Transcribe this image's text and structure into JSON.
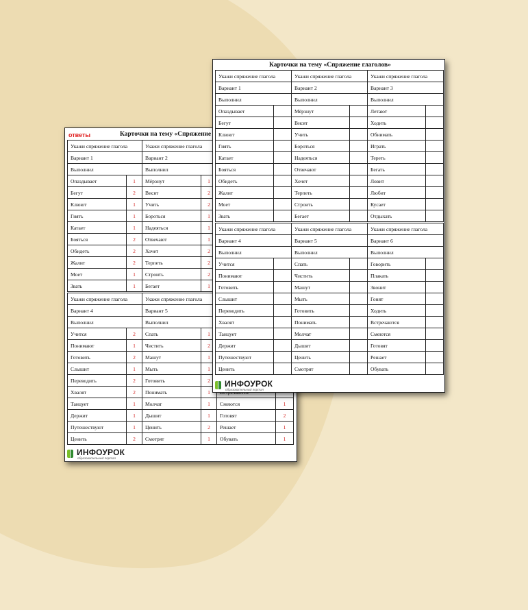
{
  "sheet_title": "Карточки на тему «Спряжение глаголов»",
  "answers_label": "ответы",
  "logo": {
    "name": "ИНФОУРОК",
    "tagline": "образовательный портал"
  },
  "labels": {
    "task": "Укажи спряжение глагола",
    "done": "Выполнил"
  },
  "cards": [
    {
      "variant": "Вариант 1",
      "verbs": [
        "Опаздывает",
        "Бегут",
        "Клюют",
        "Гиять",
        "Катает",
        "Бояться",
        "Обидеть",
        "Жалит",
        "Моет",
        "Звать"
      ],
      "answers": [
        "1",
        "2",
        "1",
        "1",
        "1",
        "2",
        "2",
        "2",
        "1",
        "1"
      ]
    },
    {
      "variant": "Вариант 2",
      "verbs": [
        "Мёрзнут",
        "Висят",
        "Учить",
        "Бороться",
        "Надеяться",
        "Отвечают",
        "Хочет",
        "Терпеть",
        "Строить",
        "Бегает"
      ],
      "answers": [
        "1",
        "2",
        "2",
        "1",
        "1",
        "1",
        "2",
        "2",
        "2",
        "1"
      ]
    },
    {
      "variant": "Вариант 3",
      "verbs": [
        "Летают",
        "Ходить",
        "Обнимать",
        "Играть",
        "Тереть",
        "Бегать",
        "Ловит",
        "Любит",
        "Кусает",
        "Отдыхать"
      ],
      "answers": []
    },
    {
      "variant": "Вариант 4",
      "verbs": [
        "Учится",
        "Понимают",
        "Готовить",
        "Слышит",
        "Переводить",
        "Хвалят",
        "Танцует",
        "Держит",
        "Путешествуют",
        "Ценить"
      ],
      "answers": [
        "2",
        "1",
        "2",
        "1",
        "2",
        "2",
        "1",
        "1",
        "1",
        "2"
      ]
    },
    {
      "variant": "Вариант 5",
      "verbs": [
        "Спать",
        "Чистить",
        "Машут",
        "Мыть",
        "Готовить",
        "Понимать",
        "Молчат",
        "Дышит",
        "Ценить",
        "Смотрят"
      ],
      "answers": [
        "1",
        "2",
        "1",
        "1",
        "2",
        "1",
        "1",
        "1",
        "2",
        "1"
      ]
    },
    {
      "variant": "Вариант 6",
      "verbs": [
        "Говорить",
        "Плакать",
        "Звонит",
        "Гонят",
        "Ходить",
        "Встречаются",
        "Смеются",
        "Готовят",
        "Решает",
        "Обувать"
      ],
      "answers": [
        "",
        "",
        "",
        "",
        "",
        "",
        "1",
        "2",
        "1",
        "1"
      ]
    }
  ]
}
